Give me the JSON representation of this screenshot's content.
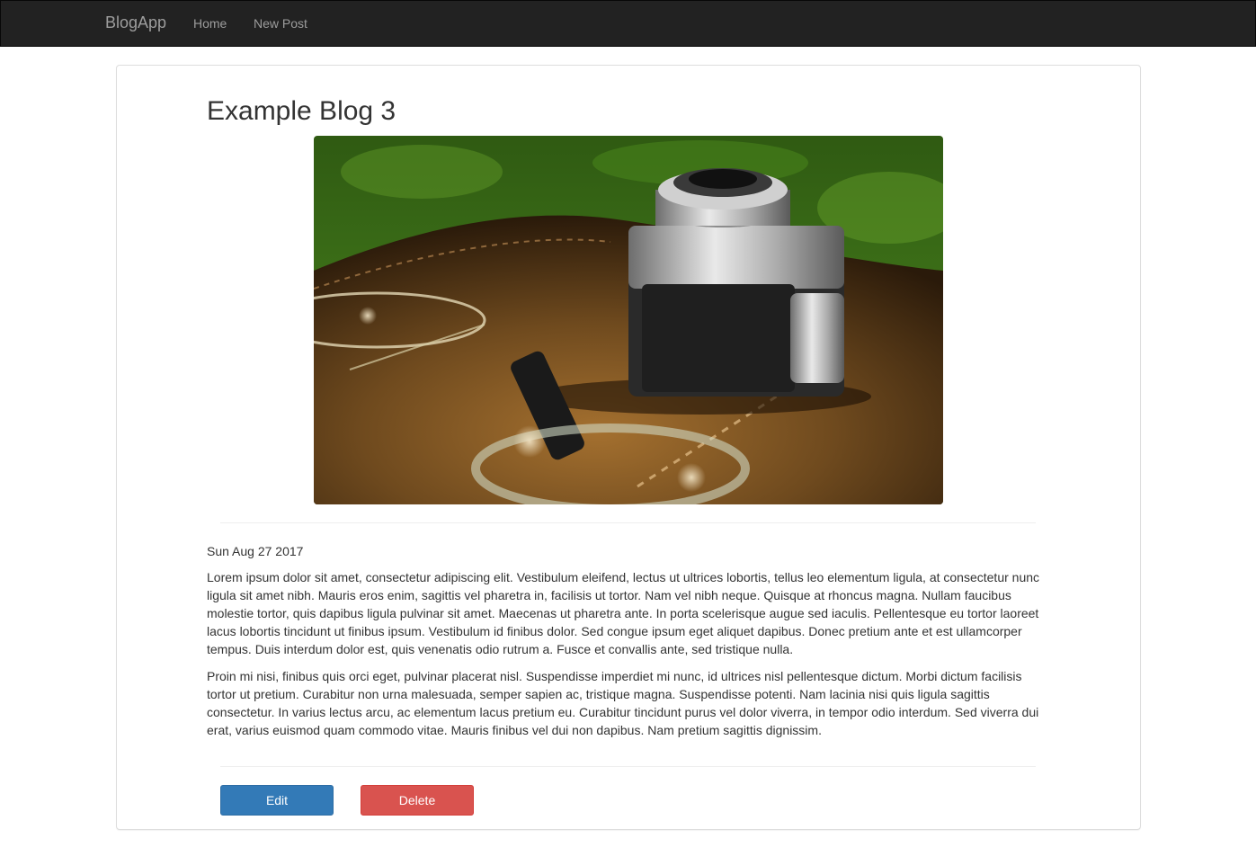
{
  "navbar": {
    "brand": "BlogApp",
    "links": [
      {
        "label": "Home"
      },
      {
        "label": "New Post"
      }
    ]
  },
  "post": {
    "title": "Example Blog 3",
    "image_subject": "vintage camera, eyeglasses and magnifying glass on brown leather",
    "date": "Sun Aug 27 2017",
    "paragraphs": [
      "Lorem ipsum dolor sit amet, consectetur adipiscing elit. Vestibulum eleifend, lectus ut ultrices lobortis, tellus leo elementum ligula, at consectetur nunc ligula sit amet nibh. Mauris eros enim, sagittis vel pharetra in, facilisis ut tortor. Nam vel nibh neque. Quisque at rhoncus magna. Nullam faucibus molestie tortor, quis dapibus ligula pulvinar sit amet. Maecenas ut pharetra ante. In porta scelerisque augue sed iaculis. Pellentesque eu tortor laoreet lacus lobortis tincidunt ut finibus ipsum. Vestibulum id finibus dolor. Sed congue ipsum eget aliquet dapibus. Donec pretium ante et est ullamcorper tempus. Duis interdum dolor est, quis venenatis odio rutrum a. Fusce et convallis ante, sed tristique nulla.",
      "Proin mi nisi, finibus quis orci eget, pulvinar placerat nisl. Suspendisse imperdiet mi nunc, id ultrices nisl pellentesque dictum. Morbi dictum facilisis tortor ut pretium. Curabitur non urna malesuada, semper sapien ac, tristique magna. Suspendisse potenti. Nam lacinia nisi quis ligula sagittis consectetur. In varius lectus arcu, ac elementum lacus pretium eu. Curabitur tincidunt purus vel dolor viverra, in tempor odio interdum. Sed viverra dui erat, varius euismod quam commodo vitae. Mauris finibus vel dui non dapibus. Nam pretium sagittis dignissim."
    ]
  },
  "actions": {
    "edit_label": "Edit",
    "delete_label": "Delete"
  },
  "colors": {
    "navbar_bg": "#222222",
    "primary": "#337ab7",
    "danger": "#d9534f"
  }
}
